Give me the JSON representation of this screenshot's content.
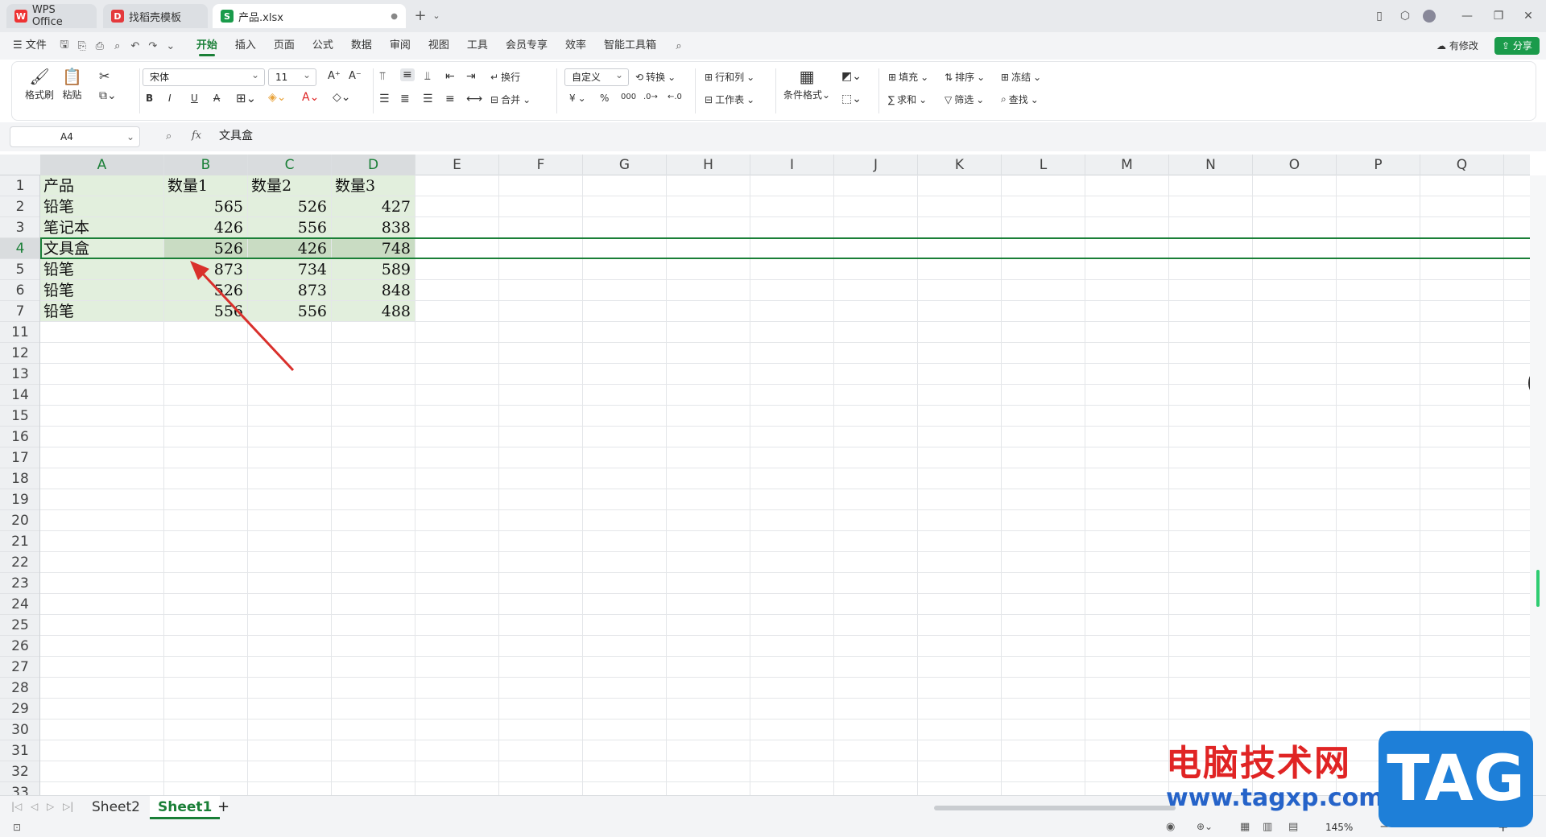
{
  "tabs": [
    {
      "label": "WPS Office",
      "icon": "wps-logo-icon"
    },
    {
      "label": "找稻壳模板",
      "icon": "docer-logo-icon"
    },
    {
      "label": "产品.xlsx",
      "icon": "sheet-file-icon"
    }
  ],
  "menu": {
    "file_label": "文件",
    "items": [
      "开始",
      "插入",
      "页面",
      "公式",
      "数据",
      "审阅",
      "视图",
      "工具",
      "会员专享",
      "效率",
      "智能工具箱"
    ],
    "active": "开始",
    "modified_label": "有修改",
    "share_label": "分享"
  },
  "ribbon": {
    "format_painter": "格式刷",
    "paste": "粘贴",
    "font_name": "宋体",
    "font_size": "11",
    "wrap": "换行",
    "merge": "合并",
    "number_format": "自定义",
    "convert": "转换",
    "row_col": "行和列",
    "worksheet": "工作表",
    "cond_format": "条件格式",
    "fill": "填充",
    "sort": "排序",
    "freeze": "冻结",
    "sum": "求和",
    "filter": "筛选",
    "find": "查找",
    "bold": "B",
    "italic": "I",
    "underline": "U",
    "currency": "¥",
    "percent": "%"
  },
  "formula_bar": {
    "name_box": "A4",
    "fx": "fx",
    "content": "文具盒"
  },
  "columns": [
    "A",
    "B",
    "C",
    "D",
    "E",
    "F",
    "G",
    "H",
    "I",
    "J",
    "K",
    "L",
    "M",
    "N",
    "O",
    "P",
    "Q"
  ],
  "rows": [
    "1",
    "2",
    "3",
    "4",
    "5",
    "6",
    "7",
    "11",
    "12",
    "13",
    "14",
    "15",
    "16",
    "17",
    "18",
    "19",
    "20",
    "21",
    "22",
    "23",
    "24",
    "25",
    "26",
    "27",
    "28",
    "29",
    "30",
    "31",
    "32",
    "33"
  ],
  "table": [
    [
      "产品",
      "数量1",
      "数量2",
      "数量3"
    ],
    [
      "铅笔",
      "565",
      "526",
      "427"
    ],
    [
      "笔记本",
      "426",
      "556",
      "838"
    ],
    [
      "文具盒",
      "526",
      "426",
      "748"
    ],
    [
      "铅笔",
      "873",
      "734",
      "589"
    ],
    [
      "铅笔",
      "526",
      "873",
      "848"
    ],
    [
      "铅笔",
      "556",
      "556",
      "488"
    ]
  ],
  "selected_row": "4",
  "sheets": [
    "Sheet2",
    "Sheet1"
  ],
  "active_sheet": "Sheet1",
  "zoom": "145%",
  "watermark": {
    "site_cn": "电脑技术网",
    "url": "www.tagxp.com",
    "logo": "TAG"
  },
  "colors": {
    "accent": "#1a7f37",
    "data_fill": "#e2efdd",
    "selected_fill": "#c9dcc3",
    "arrow": "#d9302c"
  }
}
